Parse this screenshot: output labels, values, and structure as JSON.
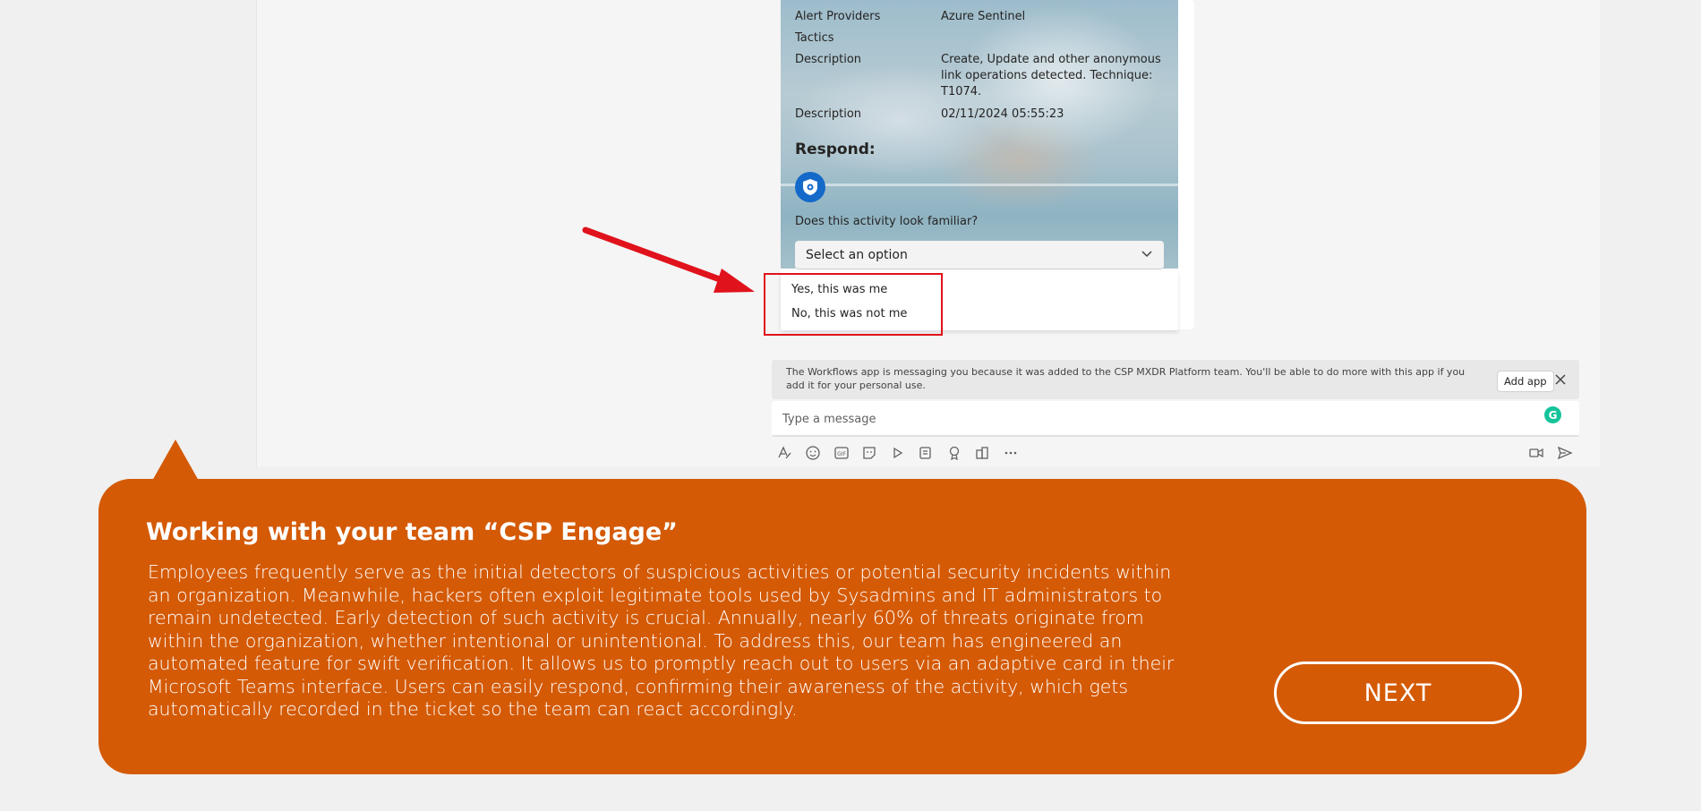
{
  "card": {
    "facts": [
      {
        "key": "Alert Providers",
        "value": "Azure Sentinel"
      },
      {
        "key": "Tactics",
        "value": ""
      },
      {
        "key": "Description",
        "value": "Create, Update and other anonymous link operations detected. Technique: T1074."
      },
      {
        "key": "Description",
        "value": "02/11/2024 05:55:23"
      }
    ],
    "respond_label": "Respond:",
    "question": "Does this activity look familiar?",
    "select_placeholder": "Select an option",
    "options": [
      "Yes, this was me",
      "No, this was not me"
    ]
  },
  "compose": {
    "notice": "The Workflows app is messaging you because it was added to the CSP MXDR Platform team. You'll be able to do more with this app if you add it for your personal use.",
    "add_app_label": "Add app",
    "placeholder": "Type a message"
  },
  "callout": {
    "title": "Working with your team “CSP Engage”",
    "body": "Employees frequently serve as the initial detectors of suspicious activities or potential security incidents within an organization. Meanwhile, hackers often exploit legitimate tools used by Sysadmins and IT administrators to remain undetected. Early detection of such activity is crucial. Annually, nearly 60% of threats originate from within the organization, whether intentional or unintentional. To address this, our team has engineered an automated feature for swift verification. It allows us to promptly reach out to users via an adaptive card in their Microsoft Teams interface. Users can easily respond, confirming their awareness of the activity, which gets automatically recorded in the ticket so the team can react accordingly.",
    "next_label": "NEXT"
  },
  "colors": {
    "accent": "#d45a06",
    "highlight": "#e0121c",
    "shield": "#1469c9"
  }
}
